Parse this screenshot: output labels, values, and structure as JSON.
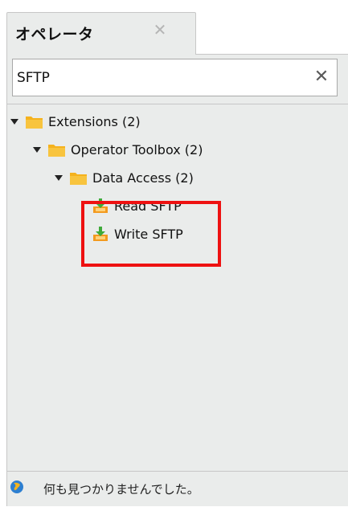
{
  "tab": {
    "title": "オペレータ",
    "close_symbol": "✕"
  },
  "search": {
    "value": "SFTP",
    "clear_symbol": "✕"
  },
  "tree": {
    "extensions": "Extensions (2)",
    "operator_toolbox": "Operator Toolbox (2)",
    "data_access": "Data Access (2)",
    "read_sftp": "Read SFTP",
    "write_sftp": "Write SFTP"
  },
  "status": {
    "message": "何も見つかりませんでした。",
    "icon": "globe-icon"
  },
  "colors": {
    "panel_bg": "#eaeceb",
    "highlight": "#ee1111",
    "folder": "#f5b21d"
  }
}
